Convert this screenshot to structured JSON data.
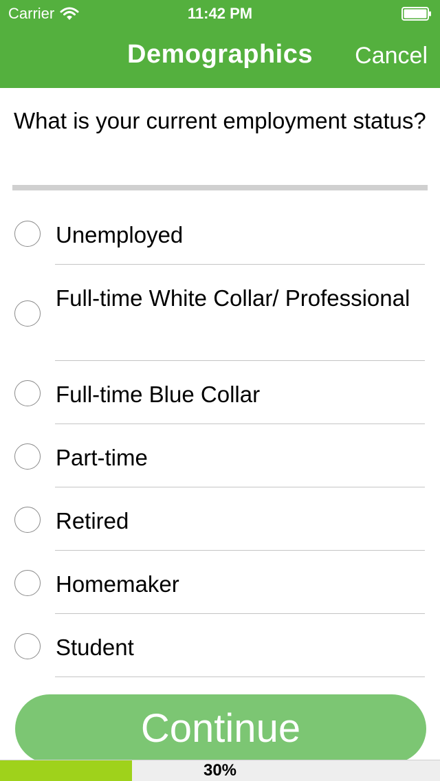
{
  "status_bar": {
    "carrier": "Carrier",
    "time": "11:42 PM",
    "wifi_icon": "wifi-icon",
    "battery_icon": "battery-icon"
  },
  "nav": {
    "title": "Demographics",
    "cancel_label": "Cancel"
  },
  "question": "What is your current employment status?",
  "options": [
    {
      "label": "Unemployed",
      "selected": false
    },
    {
      "label": "Full-time White Collar/ Professional",
      "selected": false
    },
    {
      "label": "Full-time Blue Collar",
      "selected": false
    },
    {
      "label": "Part-time",
      "selected": false
    },
    {
      "label": "Retired",
      "selected": false
    },
    {
      "label": "Homemaker",
      "selected": false
    },
    {
      "label": "Student",
      "selected": false
    }
  ],
  "continue_label": "Continue",
  "progress": {
    "value": 0.3,
    "label": "30%"
  },
  "colors": {
    "header": "#54b03e",
    "continue": "#7cc673",
    "progress_fill": "#9fd21b"
  }
}
